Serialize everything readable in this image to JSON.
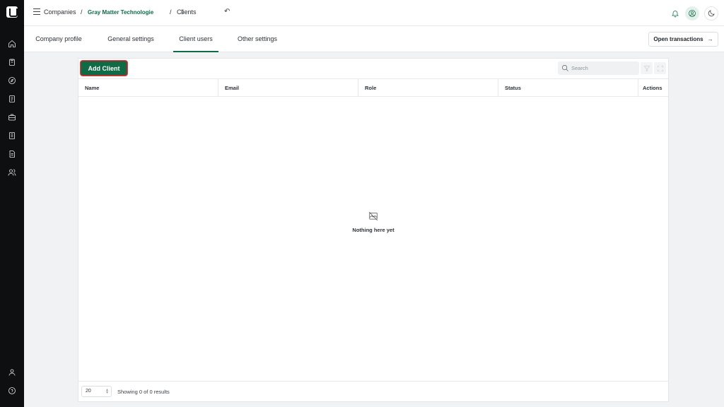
{
  "sidebar": {
    "top_icons": [
      "home-icon",
      "clipboard-icon",
      "compass-icon",
      "document-icon",
      "briefcase-icon",
      "ledger-icon",
      "report-icon",
      "users-icon"
    ],
    "bottom_icons": [
      "user-icon",
      "help-icon"
    ]
  },
  "header": {
    "breadcrumb": {
      "companies": "Companies",
      "sep1": "/",
      "company": "Gray Matter Technologie",
      "sep2": "/",
      "page": "Clients"
    }
  },
  "tabs": {
    "items": [
      {
        "label": "Company profile"
      },
      {
        "label": "General settings"
      },
      {
        "label": "Client users"
      },
      {
        "label": "Other settings"
      }
    ],
    "active": "Client users",
    "open_transactions": "Open transactions"
  },
  "toolbar": {
    "add_client": "Add Client",
    "search_placeholder": "Search"
  },
  "table": {
    "columns": [
      "Name",
      "Email",
      "Role",
      "Status",
      "Actions"
    ],
    "rows": [],
    "empty_text": "Nothing here yet"
  },
  "pagination": {
    "page_size": "20",
    "results_text": "Showing 0 of 0 results"
  },
  "colors": {
    "accent": "#0f6b46",
    "sidebar_bg": "#0d0f10"
  }
}
